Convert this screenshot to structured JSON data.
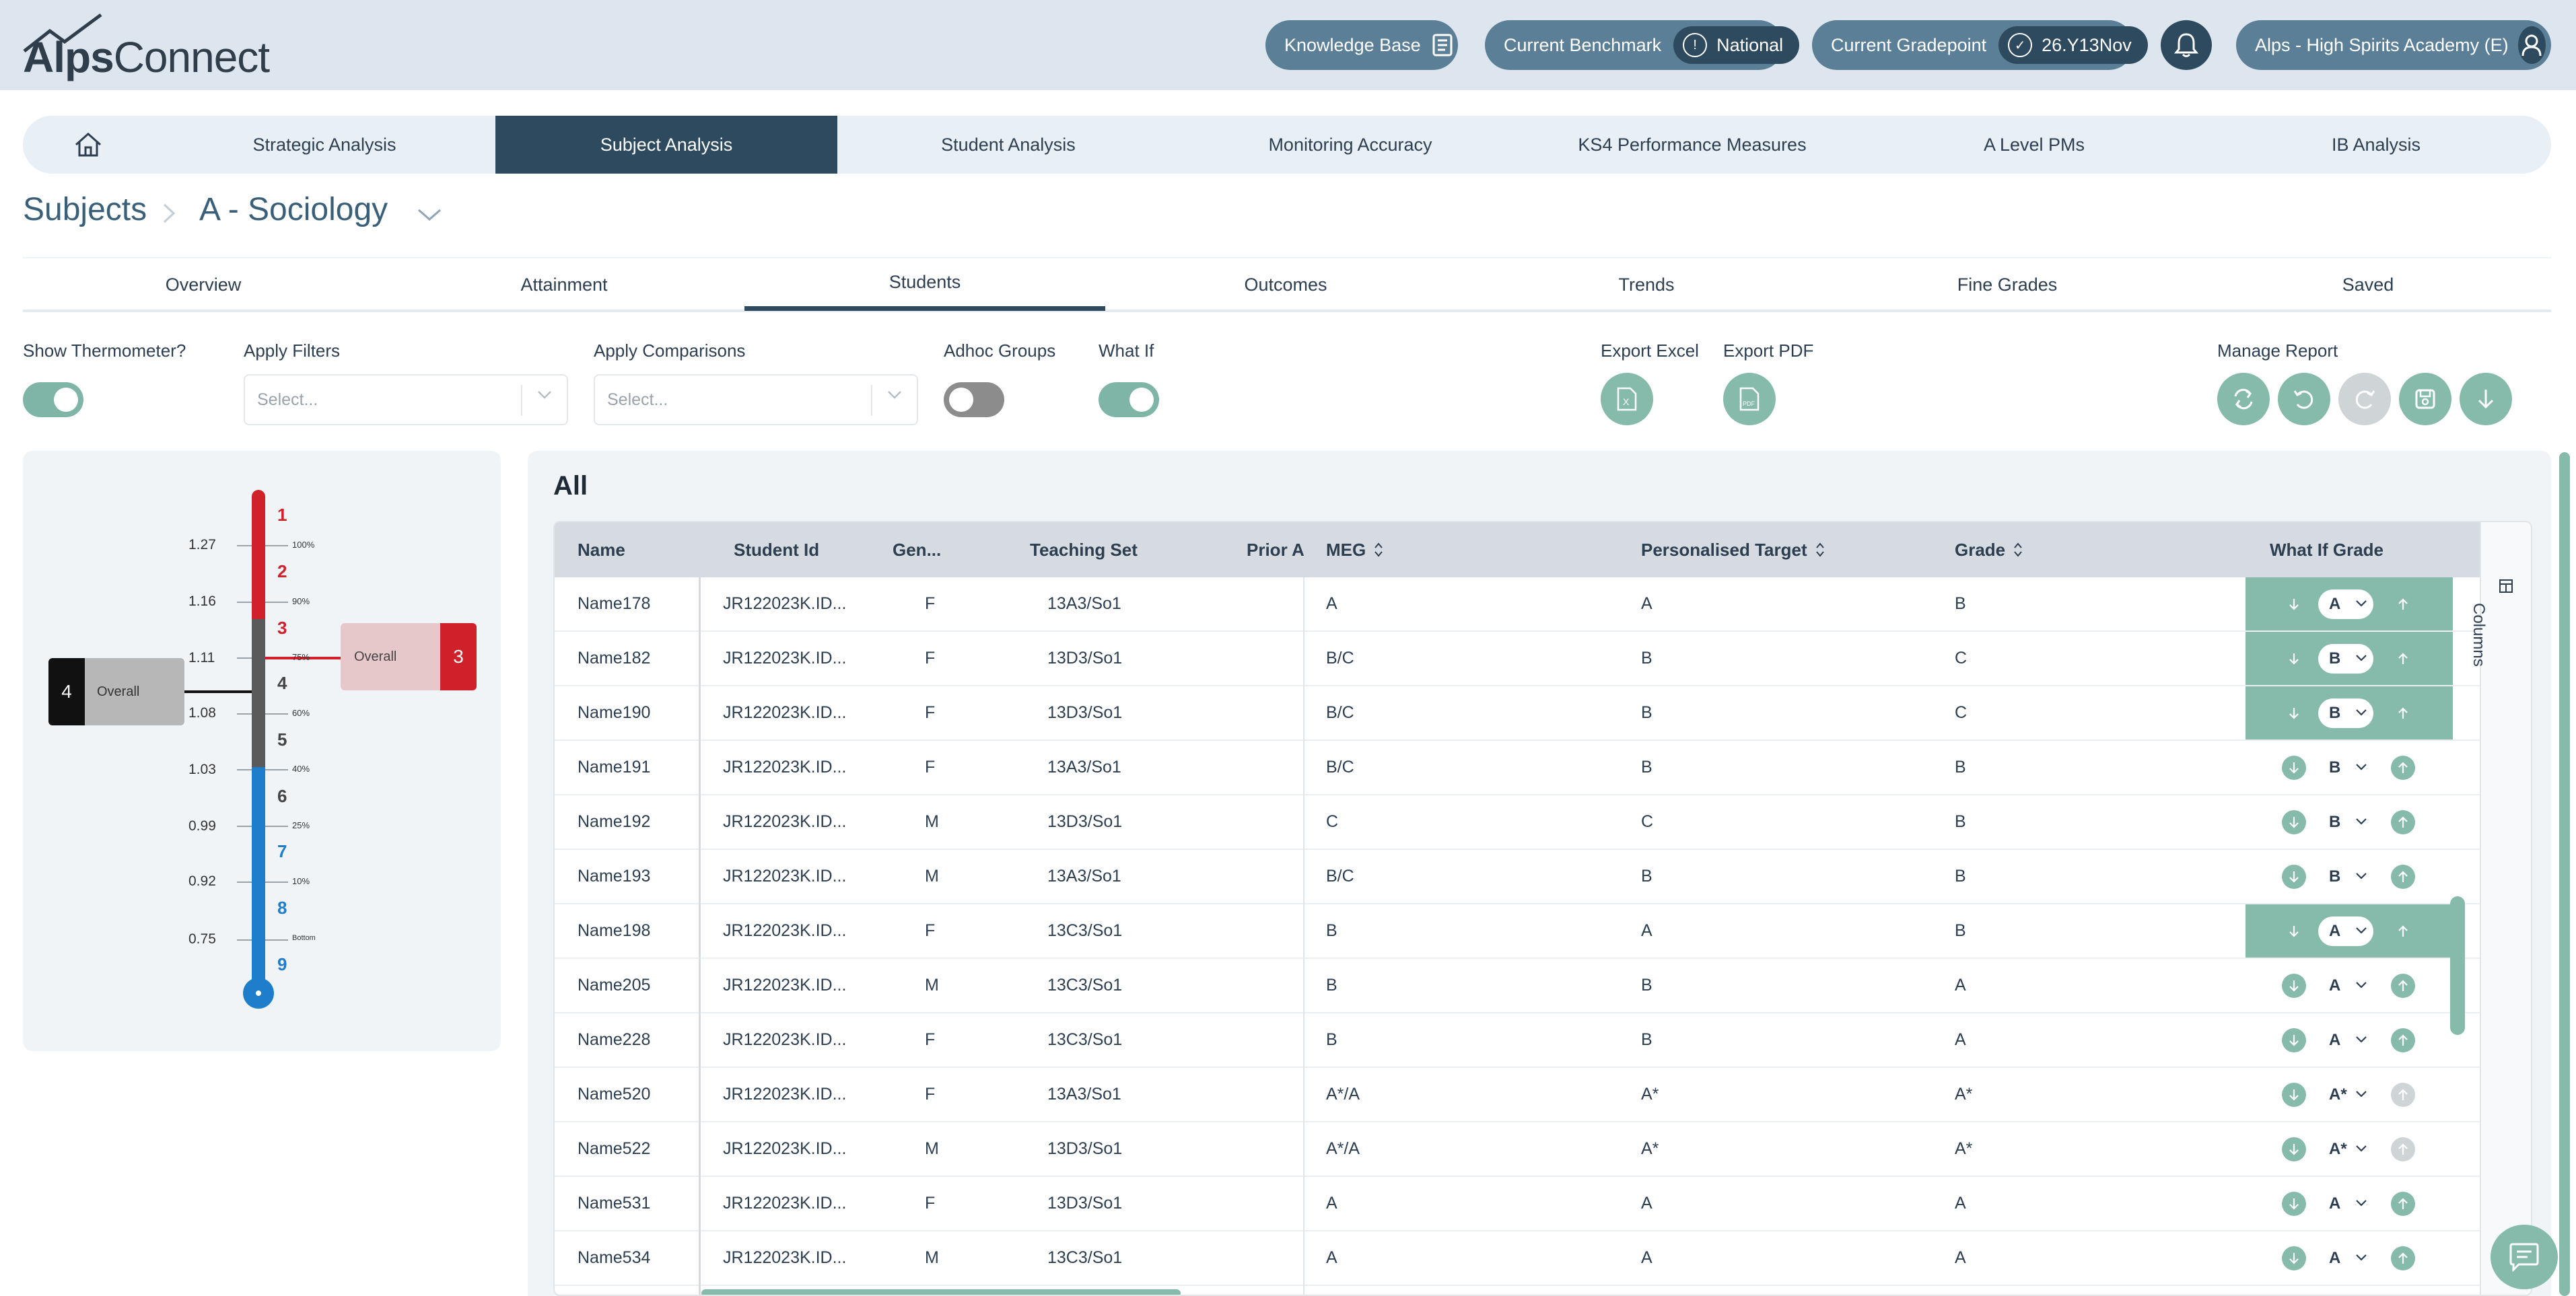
{
  "app": {
    "logo_part1": "Alps",
    "logo_part2": "Connect"
  },
  "header": {
    "knowledge_base": "Knowledge Base",
    "benchmark_label": "Current Benchmark",
    "benchmark_value": "National",
    "gradepoint_label": "Current Gradepoint",
    "gradepoint_value": "26.Y13Nov",
    "school": "Alps - High Spirits Academy (E)"
  },
  "nav": {
    "items": [
      "Strategic Analysis",
      "Subject Analysis",
      "Student Analysis",
      "Monitoring Accuracy",
      "KS4 Performance Measures",
      "A Level PMs",
      "IB Analysis"
    ],
    "active": "Subject Analysis"
  },
  "breadcrumb": {
    "root": "Subjects",
    "current": "A - Sociology"
  },
  "subtabs": {
    "items": [
      "Overview",
      "Attainment",
      "Students",
      "Outcomes",
      "Trends",
      "Fine Grades",
      "Saved"
    ],
    "active": "Students"
  },
  "controls": {
    "show_thermometer": "Show Thermometer?",
    "apply_filters": "Apply Filters",
    "apply_comparisons": "Apply Comparisons",
    "adhoc_groups": "Adhoc Groups",
    "what_if": "What If",
    "export_excel": "Export Excel",
    "export_pdf": "Export PDF",
    "manage_report": "Manage Report",
    "select_placeholder": "Select...",
    "thermometer_on": true,
    "adhoc_on": false,
    "what_if_on": true
  },
  "thermometer": {
    "grades": [
      "1",
      "2",
      "3",
      "4",
      "5",
      "6",
      "7",
      "8",
      "9"
    ],
    "scores": [
      "1.27",
      "1.16",
      "1.11",
      "1.08",
      "1.03",
      "0.99",
      "0.92",
      "0.75"
    ],
    "percentiles": [
      "100%",
      "90%",
      "75%",
      "60%",
      "40%",
      "25%",
      "10%",
      "Bottom"
    ],
    "left_marker": {
      "grade": "4",
      "label": "Overall"
    },
    "right_marker": {
      "grade": "3",
      "label": "Overall"
    }
  },
  "table": {
    "title": "All",
    "columns": [
      "Name",
      "Student Id",
      "Gen...",
      "Teaching Set",
      "Prior A",
      "MEG",
      "Personalised Target",
      "Grade",
      "What If Grade"
    ],
    "columns_toggle": "Columns",
    "rows": [
      {
        "name": "Name178",
        "id": "JR122023K.ID...",
        "gender": "F",
        "set": "13A3/So1",
        "meg": "A",
        "target": "A",
        "grade": "B",
        "whatif": "A",
        "highlight": true,
        "up": "plain"
      },
      {
        "name": "Name182",
        "id": "JR122023K.ID...",
        "gender": "F",
        "set": "13D3/So1",
        "meg": "B/C",
        "target": "B",
        "grade": "C",
        "whatif": "B",
        "highlight": true,
        "up": "plain"
      },
      {
        "name": "Name190",
        "id": "JR122023K.ID...",
        "gender": "F",
        "set": "13D3/So1",
        "meg": "B/C",
        "target": "B",
        "grade": "C",
        "whatif": "B",
        "highlight": true,
        "up": "plain"
      },
      {
        "name": "Name191",
        "id": "JR122023K.ID...",
        "gender": "F",
        "set": "13A3/So1",
        "meg": "B/C",
        "target": "B",
        "grade": "B",
        "whatif": "B",
        "highlight": false,
        "up": "g"
      },
      {
        "name": "Name192",
        "id": "JR122023K.ID...",
        "gender": "M",
        "set": "13D3/So1",
        "meg": "C",
        "target": "C",
        "grade": "B",
        "whatif": "B",
        "highlight": false,
        "up": "g"
      },
      {
        "name": "Name193",
        "id": "JR122023K.ID...",
        "gender": "M",
        "set": "13A3/So1",
        "meg": "B/C",
        "target": "B",
        "grade": "B",
        "whatif": "B",
        "highlight": false,
        "up": "g"
      },
      {
        "name": "Name198",
        "id": "JR122023K.ID...",
        "gender": "F",
        "set": "13C3/So1",
        "meg": "B",
        "target": "A",
        "grade": "B",
        "whatif": "A",
        "highlight": true,
        "up": "plain"
      },
      {
        "name": "Name205",
        "id": "JR122023K.ID...",
        "gender": "M",
        "set": "13C3/So1",
        "meg": "B",
        "target": "B",
        "grade": "A",
        "whatif": "A",
        "highlight": false,
        "up": "g"
      },
      {
        "name": "Name228",
        "id": "JR122023K.ID...",
        "gender": "F",
        "set": "13C3/So1",
        "meg": "B",
        "target": "B",
        "grade": "A",
        "whatif": "A",
        "highlight": false,
        "up": "g"
      },
      {
        "name": "Name520",
        "id": "JR122023K.ID...",
        "gender": "F",
        "set": "13A3/So1",
        "meg": "A*/A",
        "target": "A*",
        "grade": "A*",
        "whatif": "A*",
        "highlight": false,
        "up": "dim"
      },
      {
        "name": "Name522",
        "id": "JR122023K.ID...",
        "gender": "M",
        "set": "13D3/So1",
        "meg": "A*/A",
        "target": "A*",
        "grade": "A*",
        "whatif": "A*",
        "highlight": false,
        "up": "dim"
      },
      {
        "name": "Name531",
        "id": "JR122023K.ID...",
        "gender": "F",
        "set": "13D3/So1",
        "meg": "A",
        "target": "A",
        "grade": "A",
        "whatif": "A",
        "highlight": false,
        "up": "g"
      },
      {
        "name": "Name534",
        "id": "JR122023K.ID...",
        "gender": "M",
        "set": "13C3/So1",
        "meg": "A",
        "target": "A",
        "grade": "A",
        "whatif": "A",
        "highlight": false,
        "up": "g"
      }
    ]
  },
  "colors": {
    "primary_dark": "#2e4a5e",
    "accent_teal": "#86bbab",
    "header_bg": "#dde6ee",
    "thermo_red": "#d0202a",
    "thermo_blue": "#1f7ecb"
  }
}
